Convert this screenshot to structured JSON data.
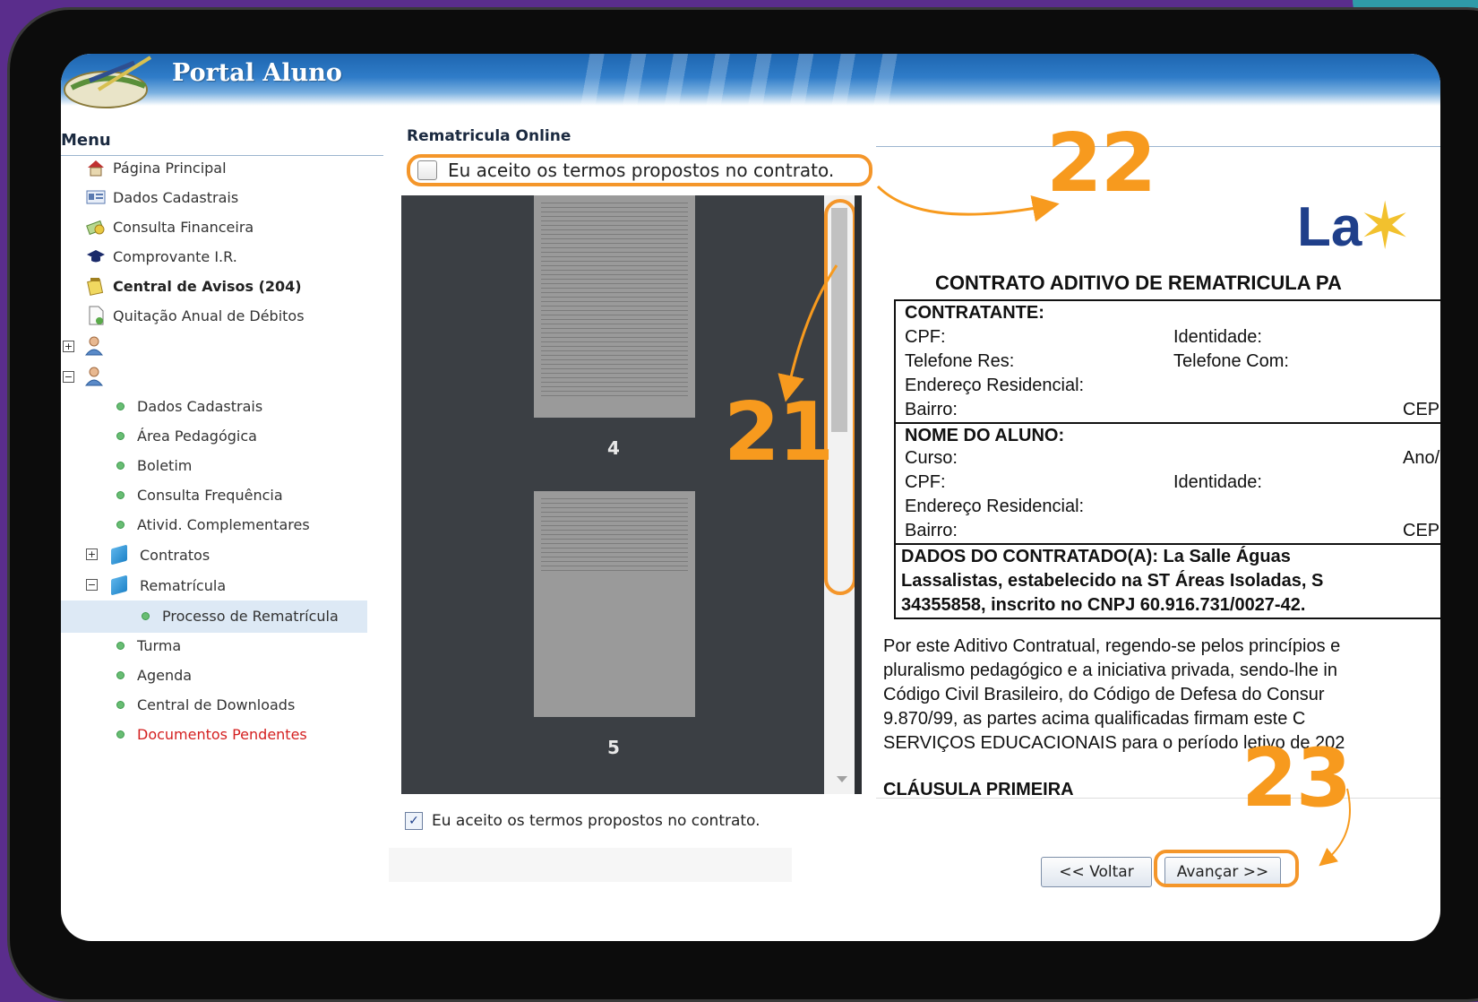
{
  "header": {
    "title": "Portal Aluno"
  },
  "menu": {
    "title": "Menu",
    "items": [
      {
        "label": "Página Principal",
        "icon": "house-icon"
      },
      {
        "label": "Dados Cadastrais",
        "icon": "id-card-icon"
      },
      {
        "label": "Consulta Financeira",
        "icon": "money-icon"
      },
      {
        "label": "Comprovante I.R.",
        "icon": "graduation-cap-icon"
      },
      {
        "label": "Central de Avisos (204)",
        "icon": "notepad-icon"
      },
      {
        "label": "Quitação Anual de Débitos",
        "icon": "document-icon"
      }
    ],
    "sub_items": [
      {
        "label": "Dados Cadastrais"
      },
      {
        "label": "Área Pedagógica"
      },
      {
        "label": "Boletim"
      },
      {
        "label": "Consulta Frequência"
      },
      {
        "label": "Ativid. Complementares"
      },
      {
        "label": "Contratos"
      },
      {
        "label": "Rematrícula"
      },
      {
        "label": "Processo de Rematrícula"
      },
      {
        "label": "Turma"
      },
      {
        "label": "Agenda"
      },
      {
        "label": "Central de Downloads"
      },
      {
        "label": "Documentos Pendentes"
      }
    ]
  },
  "main": {
    "title": "Rematricula Online",
    "accept_label": "Eu aceito os termos propostos no contrato.",
    "accept_checked_top": false,
    "accept_checked_bottom": true,
    "viewer": {
      "page_numbers": [
        "4",
        "5"
      ]
    },
    "contract": {
      "logo_text": "La",
      "title": "CONTRATO ADITIVO DE REMATRICULA PA",
      "contratante": "CONTRATANTE:",
      "cpf": "CPF:",
      "identidade": "Identidade:",
      "telefone_res": "Telefone Res:",
      "telefone_com": "Telefone Com:",
      "endereco": "Endereço Residencial:",
      "bairro": "Bairro:",
      "cep": "CEP",
      "nome_aluno": "NOME DO ALUNO:",
      "curso": "Curso:",
      "ano": "Ano/",
      "dados_1": "DADOS DO CONTRATADO(A): La Salle Águas",
      "dados_2": "Lassalistas, estabelecido na ST Áreas Isoladas, S",
      "dados_3": "34355858, inscrito no CNPJ 60.916.731/0027-42.",
      "para_1": "Por este Aditivo Contratual, regendo-se pelos princípios e",
      "para_2": "pluralismo pedagógico e a iniciativa privada, sendo-lhe in",
      "para_3": "Código Civil Brasileiro, do Código de Defesa do Consur",
      "para_4": "9.870/99, as partes acima qualificadas firmam este C",
      "para_5": "SERVIÇOS EDUCACIONAIS para o período letivo de 202",
      "clause": "CLÁUSULA PRIMEIRA"
    },
    "buttons": {
      "back": "<< Voltar",
      "next": "Avançar >>"
    }
  },
  "annotations": {
    "step_21": "21",
    "step_22": "22",
    "step_23": "23",
    "color": "#f79a1e"
  }
}
